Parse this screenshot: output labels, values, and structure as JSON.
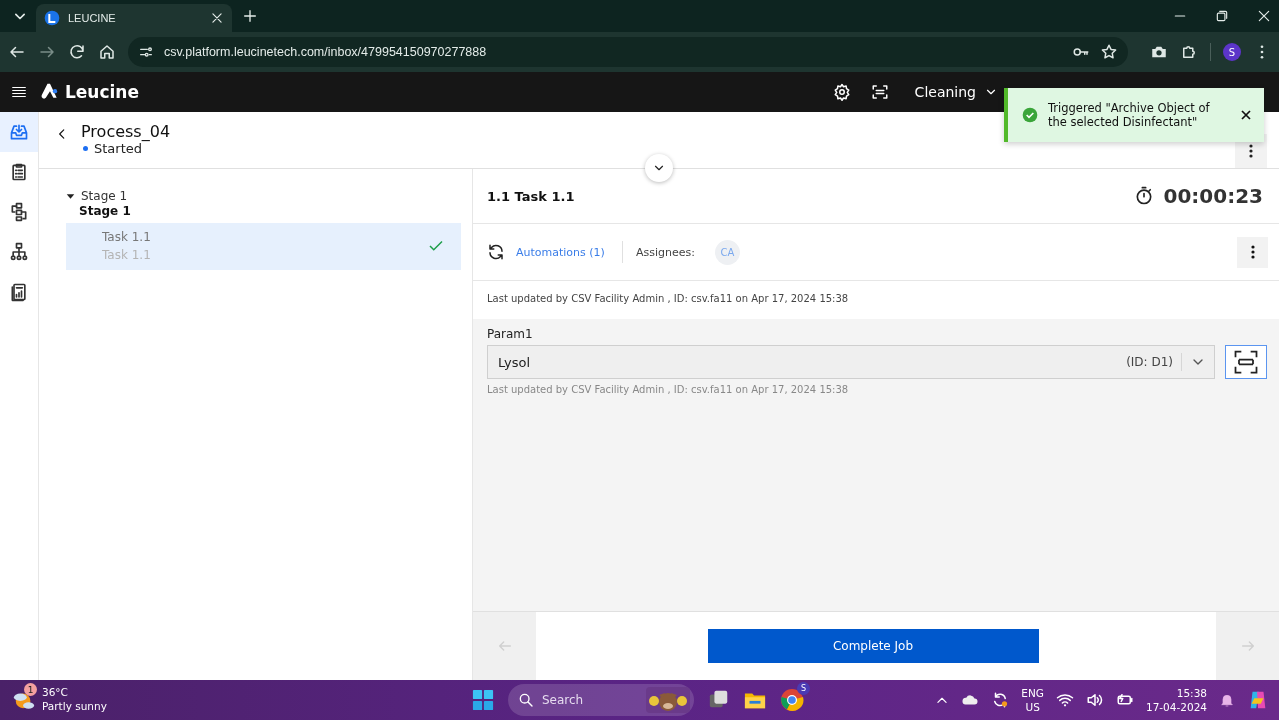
{
  "browser": {
    "tab_title": "LEUCINE",
    "url": "csv.platform.leucinetech.com/inbox/479954150970277888",
    "profile_initial": "S"
  },
  "app_header": {
    "brand": "Leucine",
    "facility": "Cleaning"
  },
  "nav_items": [
    {
      "kind": "inbox",
      "selected": true
    },
    {
      "kind": "checklist",
      "selected": false
    },
    {
      "kind": "flow",
      "selected": false
    },
    {
      "kind": "hierarchy",
      "selected": false
    },
    {
      "kind": "report",
      "selected": false
    }
  ],
  "process": {
    "title": "Process_04",
    "status": "Started"
  },
  "stages": [
    {
      "label": "Stage 1",
      "name": "Stage 1",
      "expanded": true,
      "children": [
        {
          "label": "Task 1.1",
          "name": "Task 1.1",
          "selected": true,
          "completed": true
        }
      ]
    }
  ],
  "task": {
    "title": "1.1 Task 1.1",
    "timer": "00:00:23",
    "automations": "Automations (1)",
    "assignees_label": "Assignees:",
    "assignees": [
      "CA"
    ],
    "last_updated": "Last updated by CSV Facility Admin , ID: csv.fa11 on Apr 17, 2024 15:38"
  },
  "parameters": [
    {
      "label": "Param1",
      "value": "Lysol",
      "id_text": "(ID: D1)",
      "last_updated": "Last updated by CSV Facility Admin , ID: csv.fa11 on Apr 17, 2024 15:38"
    }
  ],
  "footer": {
    "primary_button": "Complete Job",
    "prev_disabled": true,
    "next_disabled": true
  },
  "toast": {
    "message": "Triggered \"Archive Object of the selected Disinfectant\""
  },
  "taskbar": {
    "temperature": "36°C",
    "weather": "Partly sunny",
    "weather_badge": "1",
    "search_placeholder": "Search",
    "chrome_badge": "S",
    "language": "ENG",
    "region": "US",
    "time": "15:38",
    "date": "17-04-2024"
  }
}
